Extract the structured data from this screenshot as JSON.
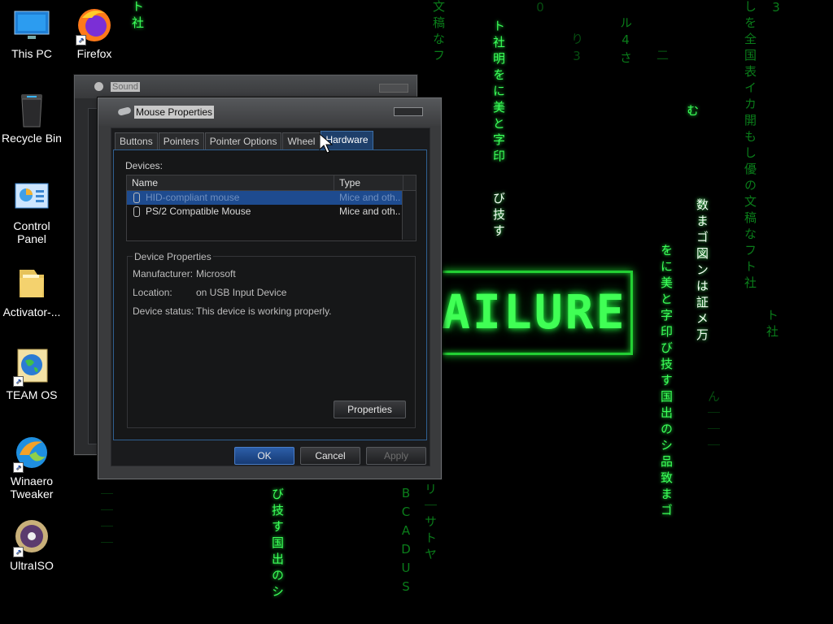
{
  "desktop": {
    "icons": [
      {
        "label": "This PC",
        "icon": "computer-icon"
      },
      {
        "label": "Firefox",
        "icon": "firefox-icon"
      },
      {
        "label": "Recycle Bin",
        "icon": "recycle-bin-icon"
      },
      {
        "label": "Control Panel",
        "icon": "control-panel-icon"
      },
      {
        "label": "Activator-...",
        "icon": "folder-icon"
      },
      {
        "label": "TEAM OS",
        "icon": "globe-icon"
      },
      {
        "label": "Winaero Tweaker",
        "icon": "winaero-icon"
      },
      {
        "label": "UltraISO",
        "icon": "disc-icon"
      }
    ],
    "wallpaper_text": "AILURE"
  },
  "sound_window": {
    "title": "Sound"
  },
  "mouse_dialog": {
    "title": "Mouse Properties",
    "tabs": [
      "Buttons",
      "Pointers",
      "Pointer Options",
      "Wheel",
      "Hardware"
    ],
    "active_tab": "Hardware",
    "devices_label": "Devices:",
    "columns": [
      "Name",
      "Type"
    ],
    "devices": [
      {
        "name": "HID-compliant mouse",
        "type": "Mice and oth...",
        "selected": true
      },
      {
        "name": "PS/2 Compatible Mouse",
        "type": "Mice and oth...",
        "selected": false
      }
    ],
    "device_properties": {
      "group_title": "Device Properties",
      "manufacturer_label": "Manufacturer:",
      "manufacturer": "Microsoft",
      "location_label": "Location:",
      "location": "on USB Input Device",
      "status_label": "Device status:",
      "status": "This device is working properly.",
      "properties_button": "Properties"
    },
    "buttons": {
      "ok": "OK",
      "cancel": "Cancel",
      "apply": "Apply"
    }
  },
  "colors": {
    "accent": "#1e4b8f",
    "matrix_green": "#3cff5a"
  }
}
